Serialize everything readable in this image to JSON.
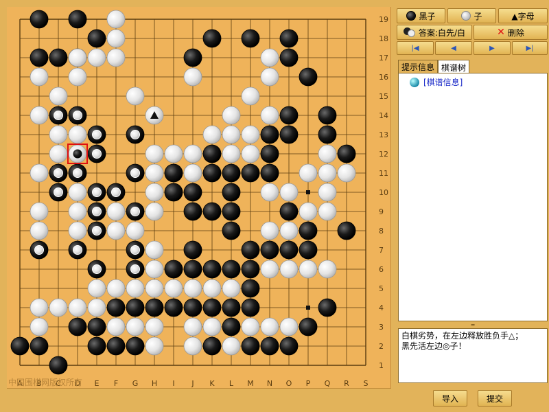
{
  "board": {
    "size": 19,
    "columns": [
      "A",
      "B",
      "C",
      "D",
      "E",
      "F",
      "G",
      "H",
      "I",
      "J",
      "K",
      "L",
      "M",
      "N",
      "O",
      "P",
      "Q",
      "R",
      "S"
    ],
    "rows": [
      "19",
      "18",
      "17",
      "16",
      "15",
      "14",
      "13",
      "12",
      "11",
      "10",
      "9",
      "8",
      "7",
      "6",
      "5",
      "4",
      "3",
      "2",
      "1"
    ],
    "watermark": "中国围棋网版权所有",
    "black_stones": [
      "B19",
      "D19",
      "E18",
      "K18",
      "M18",
      "O18",
      "B17",
      "C17",
      "D17",
      "J17",
      "O17",
      "P16",
      "O14",
      "Q14",
      "N13",
      "O13",
      "Q13",
      "K12",
      "N12",
      "R12",
      "I11",
      "K11",
      "L11",
      "M11",
      "N11",
      "I10",
      "J10",
      "L10",
      "J9",
      "K9",
      "L9",
      "O9",
      "L8",
      "P8",
      "R8",
      "J7",
      "M7",
      "N7",
      "O7",
      "P7",
      "I6",
      "J6",
      "K6",
      "L6",
      "M6",
      "M5",
      "F4",
      "G4",
      "H4",
      "I4",
      "J4",
      "K4",
      "L4",
      "M4",
      "Q4",
      "D3",
      "E3",
      "L3",
      "P3",
      "A2",
      "B2",
      "E2",
      "F2",
      "G2",
      "K2",
      "M2",
      "N2",
      "O2",
      "C1"
    ],
    "white_stones": [
      "F19",
      "F18",
      "D17",
      "E17",
      "F17",
      "N17",
      "B16",
      "D16",
      "J16",
      "N16",
      "C15",
      "G15",
      "M15",
      "B14",
      "L14",
      "N14",
      "C13",
      "D13",
      "K13",
      "L13",
      "M13",
      "C12",
      "H12",
      "I12",
      "J12",
      "L12",
      "M12",
      "Q12",
      "B11",
      "D11",
      "H11",
      "J11",
      "P11",
      "Q11",
      "R11",
      "D10",
      "H10",
      "N10",
      "O10",
      "Q10",
      "B9",
      "D9",
      "F9",
      "H9",
      "P9",
      "Q9",
      "B8",
      "D8",
      "F8",
      "G8",
      "N8",
      "O8",
      "H7",
      "H6",
      "N6",
      "O6",
      "P6",
      "Q6",
      "E5",
      "F5",
      "G5",
      "H5",
      "I5",
      "J5",
      "K5",
      "L5",
      "B4",
      "C4",
      "D4",
      "E4",
      "B3",
      "F3",
      "G3",
      "H3",
      "J3",
      "K3",
      "M3",
      "N3",
      "O3",
      "H2",
      "J2",
      "L2"
    ],
    "marked_white_stones": [
      "C14",
      "D14",
      "E13",
      "G13",
      "E12",
      "C11",
      "D11",
      "G11",
      "C10",
      "E10",
      "F10",
      "E9",
      "G9",
      "E8",
      "B7",
      "D7",
      "G7",
      "E6",
      "G6"
    ],
    "triangle_stone": "H14",
    "current_move": "D12",
    "small_marks": [
      "P10",
      "P4"
    ]
  },
  "toolbar": {
    "black_label": "黑子",
    "white_label": "子",
    "letter_label": "▲字母",
    "answer_label": "答案:白先/白",
    "delete_label": "删除",
    "nav_first_icon": "first-icon",
    "nav_prev_icon": "prev-icon",
    "nav_next_icon": "next-icon",
    "nav_last_icon": "last-icon"
  },
  "tabs": [
    "提示信息",
    "棋谱树"
  ],
  "tree": {
    "root_label": "[棋谱信息]"
  },
  "comment": "白棋劣势，在左边释放胜负手△；\n黑先活左边◎子！",
  "footer": {
    "import_label": "导入",
    "submit_label": "提交"
  },
  "colors": {
    "board": "#efb35a",
    "panel": "#e2b35a",
    "tree_link": "#1a2ac8",
    "marker_red": "#e01010"
  }
}
